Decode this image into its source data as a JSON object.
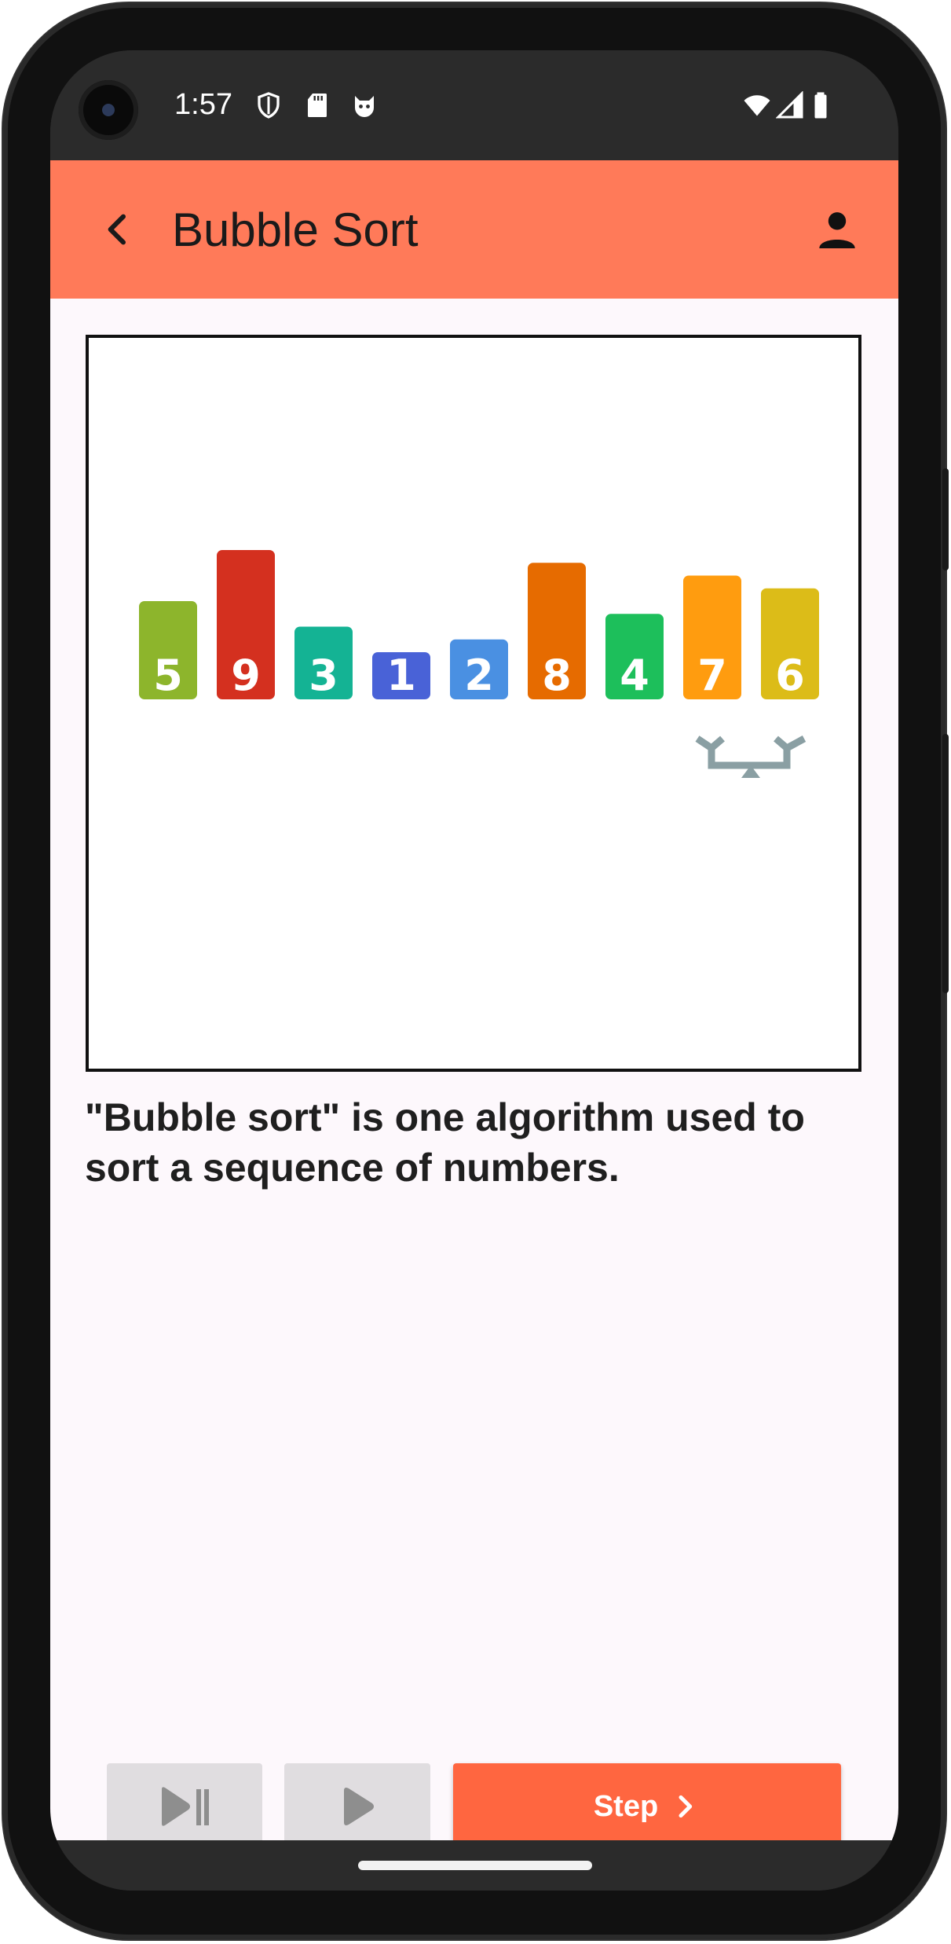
{
  "status_bar": {
    "time": "1:57",
    "left_icons": [
      "shield-icon",
      "sd-card-icon",
      "cat-face-icon"
    ],
    "right_icons": [
      "wifi-icon",
      "cell-signal-icon",
      "battery-icon"
    ]
  },
  "app_bar": {
    "title": "Bubble Sort",
    "back_icon": "chevron-left-icon",
    "account_icon": "person-icon",
    "color": "#ff7a59"
  },
  "visualization": {
    "bars": [
      {
        "value": "5",
        "color": "#8db52c"
      },
      {
        "value": "9",
        "color": "#d4301f"
      },
      {
        "value": "3",
        "color": "#14b394"
      },
      {
        "value": "1",
        "color": "#4962d7"
      },
      {
        "value": "2",
        "color": "#4a90e2"
      },
      {
        "value": "8",
        "color": "#e66b00"
      },
      {
        "value": "4",
        "color": "#1dbf5b"
      },
      {
        "value": "7",
        "color": "#ff9c0f"
      },
      {
        "value": "6",
        "color": "#dcbc18"
      }
    ],
    "scale_icon": "balance-scale-icon",
    "scale_color": "#8a9fa3"
  },
  "description": "\"Bubble sort\" is one algorithm used to sort a sequence of numbers.",
  "controls": {
    "play_pause_icon": "play-pause-icon",
    "play_icon": "play-icon",
    "step_label": "Step",
    "step_icon": "chevron-right-icon",
    "step_color": "#ff6640"
  }
}
